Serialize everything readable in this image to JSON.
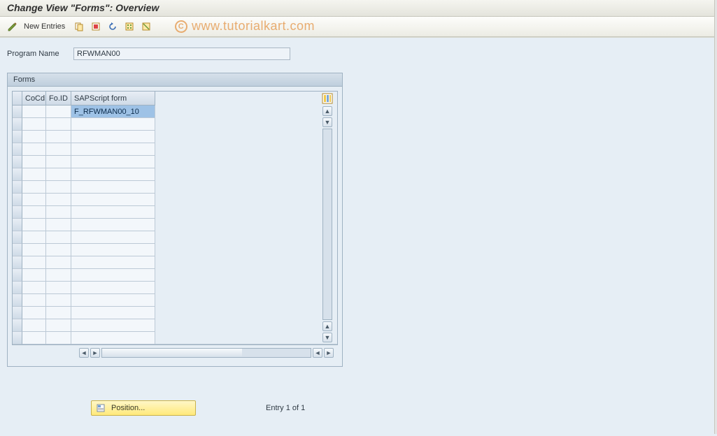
{
  "title": "Change View \"Forms\": Overview",
  "watermark": "www.tutorialkart.com",
  "toolbar": {
    "new_entries_label": "New Entries"
  },
  "program": {
    "label": "Program Name",
    "value": "RFWMAN00"
  },
  "panel": {
    "title": "Forms"
  },
  "columns": {
    "cocd": "CoCd",
    "foid": "Fo.ID",
    "form": "SAPScript form"
  },
  "rows": [
    {
      "cocd": "",
      "foid": "",
      "form": "F_RFWMAN00_10",
      "selected_form": true
    },
    {
      "cocd": "",
      "foid": "",
      "form": ""
    },
    {
      "cocd": "",
      "foid": "",
      "form": ""
    },
    {
      "cocd": "",
      "foid": "",
      "form": ""
    },
    {
      "cocd": "",
      "foid": "",
      "form": ""
    },
    {
      "cocd": "",
      "foid": "",
      "form": ""
    },
    {
      "cocd": "",
      "foid": "",
      "form": ""
    },
    {
      "cocd": "",
      "foid": "",
      "form": ""
    },
    {
      "cocd": "",
      "foid": "",
      "form": ""
    },
    {
      "cocd": "",
      "foid": "",
      "form": ""
    },
    {
      "cocd": "",
      "foid": "",
      "form": ""
    },
    {
      "cocd": "",
      "foid": "",
      "form": ""
    },
    {
      "cocd": "",
      "foid": "",
      "form": ""
    },
    {
      "cocd": "",
      "foid": "",
      "form": ""
    },
    {
      "cocd": "",
      "foid": "",
      "form": ""
    },
    {
      "cocd": "",
      "foid": "",
      "form": ""
    },
    {
      "cocd": "",
      "foid": "",
      "form": ""
    },
    {
      "cocd": "",
      "foid": "",
      "form": ""
    },
    {
      "cocd": "",
      "foid": "",
      "form": ""
    }
  ],
  "footer": {
    "position_label": "Position...",
    "entry_text": "Entry 1 of 1"
  }
}
